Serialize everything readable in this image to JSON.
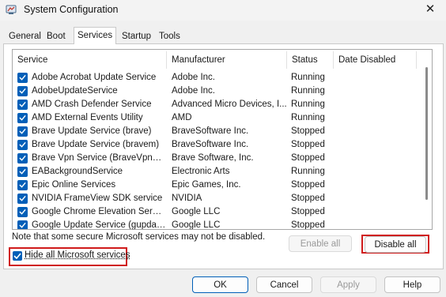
{
  "window": {
    "title": "System Configuration",
    "close_glyph": "✕"
  },
  "tabs": [
    {
      "label": "General",
      "active": false
    },
    {
      "label": "Boot",
      "active": false
    },
    {
      "label": "Services",
      "active": true
    },
    {
      "label": "Startup",
      "active": false
    },
    {
      "label": "Tools",
      "active": false
    }
  ],
  "services_table": {
    "columns": [
      "Service",
      "Manufacturer",
      "Status",
      "Date Disabled"
    ],
    "rows": [
      {
        "checked": true,
        "service": "Adobe Acrobat Update Service",
        "manufacturer": "Adobe Inc.",
        "status": "Running",
        "date_disabled": ""
      },
      {
        "checked": true,
        "service": "AdobeUpdateService",
        "manufacturer": "Adobe Inc.",
        "status": "Running",
        "date_disabled": ""
      },
      {
        "checked": true,
        "service": "AMD Crash Defender Service",
        "manufacturer": "Advanced Micro Devices, I...",
        "status": "Running",
        "date_disabled": ""
      },
      {
        "checked": true,
        "service": "AMD External Events Utility",
        "manufacturer": "AMD",
        "status": "Running",
        "date_disabled": ""
      },
      {
        "checked": true,
        "service": "Brave Update Service (brave)",
        "manufacturer": "BraveSoftware Inc.",
        "status": "Stopped",
        "date_disabled": ""
      },
      {
        "checked": true,
        "service": "Brave Update Service (bravem)",
        "manufacturer": "BraveSoftware Inc.",
        "status": "Stopped",
        "date_disabled": ""
      },
      {
        "checked": true,
        "service": "Brave Vpn Service (BraveVpnSer...",
        "manufacturer": "Brave Software, Inc.",
        "status": "Stopped",
        "date_disabled": ""
      },
      {
        "checked": true,
        "service": "EABackgroundService",
        "manufacturer": "Electronic Arts",
        "status": "Running",
        "date_disabled": ""
      },
      {
        "checked": true,
        "service": "Epic Online Services",
        "manufacturer": "Epic Games, Inc.",
        "status": "Stopped",
        "date_disabled": ""
      },
      {
        "checked": true,
        "service": "NVIDIA FrameView SDK service",
        "manufacturer": "NVIDIA",
        "status": "Stopped",
        "date_disabled": ""
      },
      {
        "checked": true,
        "service": "Google Chrome Elevation Servic...",
        "manufacturer": "Google LLC",
        "status": "Stopped",
        "date_disabled": ""
      },
      {
        "checked": true,
        "service": "Google Update Service (gupdate)",
        "manufacturer": "Google LLC",
        "status": "Stopped",
        "date_disabled": ""
      }
    ]
  },
  "note": "Note that some secure Microsoft services may not be disabled.",
  "buttons": {
    "enable_all": "Enable all",
    "disable_all": "Disable all",
    "ok": "OK",
    "cancel": "Cancel",
    "apply": "Apply",
    "help": "Help"
  },
  "hide_microsoft": {
    "label": "Hide all Microsoft services",
    "checked": true
  },
  "colors": {
    "accent": "#005fb8",
    "highlight_box": "#d01b1b"
  }
}
